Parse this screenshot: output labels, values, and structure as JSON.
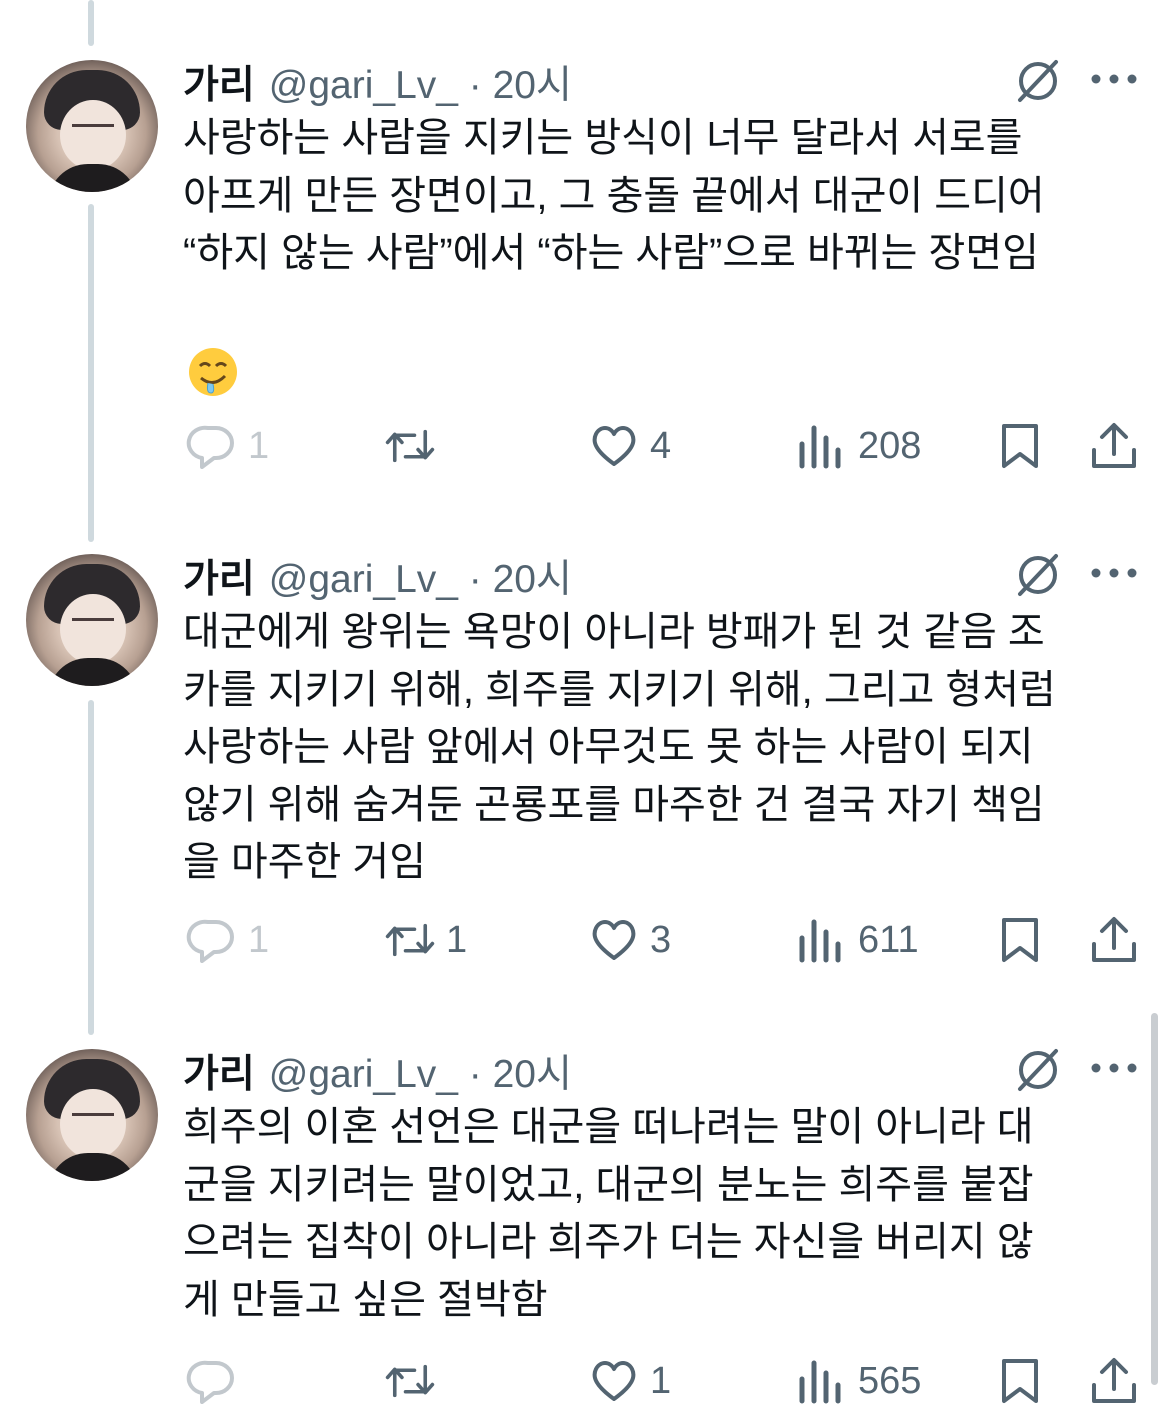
{
  "tweets": [
    {
      "name": "가리",
      "handle": "@gari_Lv_ · 20시",
      "lines": [
        "사랑하는 사람을 지키는 방식이 너무 달라서 서로를",
        "아프게 만든 장면이고, 그 충돌 끝에서 대군이 드디어",
        "“하지 않는 사람”에서 “하는 사람”으로 바뀌는 장면임"
      ],
      "emoji": "drooling-face-emoji",
      "replies": "1",
      "retweets": "",
      "likes": "4",
      "views": "208"
    },
    {
      "name": "가리",
      "handle": "@gari_Lv_ · 20시",
      "lines": [
        "대군에게 왕위는 욕망이 아니라 방패가 된 것 같음 조",
        "카를 지키기 위해, 희주를 지키기 위해, 그리고 형처럼",
        "사랑하는 사람 앞에서 아무것도 못 하는 사람이 되지",
        "않기 위해 숨겨둔 곤룡포를 마주한 건 결국 자기 책임",
        "을 마주한 거임"
      ],
      "replies": "1",
      "retweets": "1",
      "likes": "3",
      "views": "611"
    },
    {
      "name": "가리",
      "handle": "@gari_Lv_ · 20시",
      "lines": [
        "희주의 이혼 선언은 대군을 떠나려는 말이 아니라 대",
        "군을 지키려는 말이었고, 대군의 분노는 희주를 붙잡",
        "으려는 집착이 아니라 희주가 더는 자신을 버리지 않",
        "게 만들고 싶은 절박함"
      ],
      "replies": "",
      "retweets": "",
      "likes": "1",
      "views": "565"
    }
  ],
  "icons": [
    "reply-icon",
    "retweet-icon",
    "like-icon",
    "views-icon",
    "bookmark-icon",
    "share-icon",
    "grok-icon",
    "more-icon"
  ],
  "colors": {
    "text": "#0f1419",
    "secondary": "#536471",
    "line": "#cfd9de"
  }
}
